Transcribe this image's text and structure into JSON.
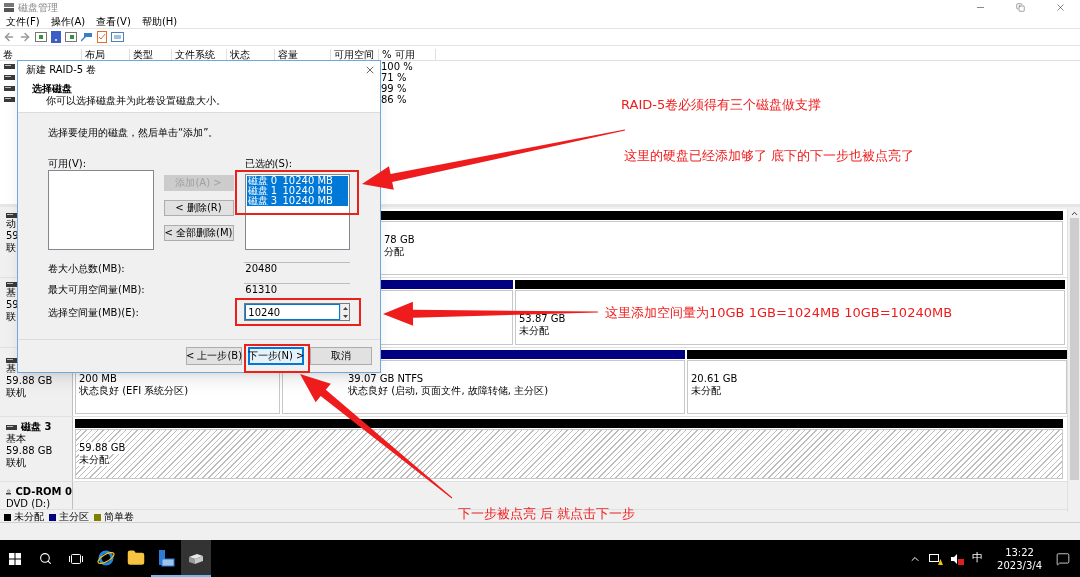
{
  "window": {
    "title": "磁盘管理"
  },
  "menu": [
    {
      "label": "文件(F)"
    },
    {
      "label": "操作(A)"
    },
    {
      "label": "查看(V)"
    },
    {
      "label": "帮助(H)"
    }
  ],
  "volume_table": {
    "columns": [
      "卷",
      "布局",
      "类型",
      "文件系统",
      "状态",
      "容量",
      "可用空间",
      "% 可用"
    ],
    "rows": [
      {
        "percent_free": "100 %"
      },
      {
        "percent_free": "71 %"
      },
      {
        "percent_free": "99 %"
      },
      {
        "percent_free": "86 %"
      }
    ]
  },
  "disks": [
    {
      "kind": "disk",
      "lines": [
        "动",
        "59",
        "联"
      ],
      "partitions": [
        {
          "kind": "unallocated",
          "selected": false,
          "lines": [
            "78 GB",
            "分配"
          ]
        }
      ]
    },
    {
      "kind": "disk",
      "lines": [
        "基",
        "59",
        "联"
      ],
      "partitions": [
        {
          "kind": "primary",
          "selected": false
        },
        {
          "kind": "unallocated",
          "selected": false,
          "lines": [
            "53.87 GB",
            "未分配"
          ]
        }
      ]
    },
    {
      "kind": "disk",
      "lines": [
        "基",
        "59.88 GB",
        "联机"
      ],
      "partitions": [
        {
          "selected": false,
          "lines": [
            "200 MB",
            "状态良好 (EFI 系统分区)"
          ]
        },
        {
          "kind": "primary",
          "selected": false,
          "lines": [
            "39.07 GB NTFS",
            "状态良好 (启动, 页面文件, 故障转储, 主分区)"
          ]
        },
        {
          "kind": "unallocated",
          "selected": false,
          "lines": [
            "20.61 GB",
            "未分配"
          ]
        }
      ]
    },
    {
      "kind": "disk",
      "name": "磁盘 3",
      "lines": [
        "基本",
        "59.88 GB",
        "联机"
      ],
      "partitions": [
        {
          "kind": "unallocated",
          "selected": true,
          "lines": [
            "59.88 GB",
            "未分配"
          ]
        }
      ]
    },
    {
      "kind": "cdrom",
      "name": "CD-ROM 0",
      "lines": [
        "DVD (D:)"
      ]
    }
  ],
  "legend": [
    {
      "label": "未分配",
      "color": "#000000"
    },
    {
      "label": "主分区",
      "color": "#000080"
    },
    {
      "label": "简单卷",
      "color": "#808000"
    }
  ],
  "dialog": {
    "title": "新建 RAID-5 卷",
    "heading": "选择磁盘",
    "subheading": "你可以选择磁盘并为此卷设置磁盘大小。",
    "instruction": "选择要使用的磁盘，然后单击“添加”。",
    "available_label": "可用(V):",
    "selected_label": "已选的(S):",
    "move_buttons": [
      {
        "label": "添加(A) >",
        "disabled": true
      },
      {
        "label": "< 删除(R)",
        "disabled": false
      },
      {
        "label": "< 全部删除(M)",
        "disabled": false
      }
    ],
    "selected_disks": [
      {
        "name": "磁盘 0",
        "size": "10240 MB",
        "selected": true
      },
      {
        "name": "磁盘 1",
        "size": "10240 MB",
        "selected": true
      },
      {
        "name": "磁盘 3",
        "size": "10240 MB",
        "selected": true
      }
    ],
    "fields": [
      {
        "kind": "readonly",
        "label": "卷大小总数(MB):",
        "value": "20480"
      },
      {
        "kind": "readonly",
        "label": "最大可用空间量(MB):",
        "value": "61310"
      },
      {
        "kind": "spin",
        "label": "选择空间量(MB)(E):",
        "value": "10240"
      }
    ],
    "buttons": [
      {
        "label": "< 上一步(B)",
        "default": false
      },
      {
        "label": "下一步(N) >",
        "default": true
      },
      {
        "label": "取消",
        "default": false
      }
    ]
  },
  "annotations": [
    {
      "text": "RAID-5卷必须得有三个磁盘做支撑"
    },
    {
      "text": "这里的硬盘已经添加够了 底下的下一步也被点亮了"
    },
    {
      "text": "这里添加空间量为10GB 1GB=1024MB 10GB=10240MB"
    },
    {
      "text": "下一步被点亮 后 就点击下一步"
    }
  ],
  "taskbar": {
    "apps": [
      {
        "selected": false
      },
      {
        "selected": false
      },
      {
        "selected": false
      },
      {
        "selected": true
      }
    ],
    "ime": "中",
    "time": "13:22",
    "date": "2023/3/4"
  }
}
